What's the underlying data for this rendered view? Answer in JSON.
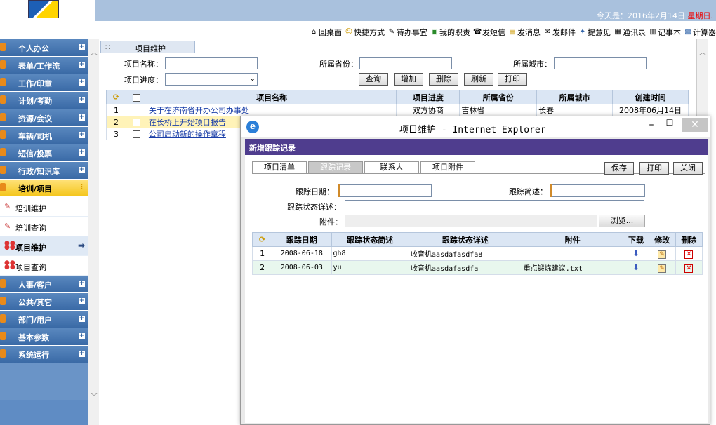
{
  "header": {
    "today_prefix": "今天是：2016年2月14日 ",
    "weekday": "星期日."
  },
  "toolbar": {
    "items": [
      {
        "label": "回桌面",
        "icon": "home-icon"
      },
      {
        "label": "快捷方式",
        "icon": "smiley-icon"
      },
      {
        "label": "待办事宜",
        "icon": "edit-note-icon"
      },
      {
        "label": "我的职责",
        "icon": "duty-icon"
      },
      {
        "label": "发短信",
        "icon": "phone-icon"
      },
      {
        "label": "发消息",
        "icon": "folder-icon"
      },
      {
        "label": "发邮件",
        "icon": "mail-icon"
      },
      {
        "label": "提意见",
        "icon": "feedback-icon"
      },
      {
        "label": "通讯录",
        "icon": "addressbook-icon"
      },
      {
        "label": "记事本",
        "icon": "notepad-icon"
      },
      {
        "label": "计算器",
        "icon": "calculator-icon"
      }
    ]
  },
  "sidebar": {
    "items": [
      {
        "label": "个人办公"
      },
      {
        "label": "表单/工作流"
      },
      {
        "label": "工作/印章"
      },
      {
        "label": "计划/考勤"
      },
      {
        "label": "资源/会议"
      },
      {
        "label": "车辆/司机"
      },
      {
        "label": "短信/投票"
      },
      {
        "label": "行政/知识库"
      },
      {
        "label": "培训/项目"
      }
    ],
    "sub_items": [
      {
        "label": "培训维护"
      },
      {
        "label": "培训查询"
      },
      {
        "label": "项目维护"
      },
      {
        "label": "项目查询"
      }
    ],
    "items_after": [
      {
        "label": "人事/客户"
      },
      {
        "label": "公共/其它"
      },
      {
        "label": "部门/用户"
      },
      {
        "label": "基本参数"
      },
      {
        "label": "系统运行"
      }
    ]
  },
  "main": {
    "tab_label": "项目维护",
    "filters": {
      "name_label": "项目名称：",
      "province_label": "所属省份：",
      "city_label": "所属城市：",
      "progress_label": "项目进度："
    },
    "buttons": {
      "query": "查询",
      "add": "增加",
      "delete": "删除",
      "refresh": "刷新",
      "print": "打印"
    },
    "table": {
      "headers": [
        "项目名称",
        "项目进度",
        "所属省份",
        "所属城市",
        "创建时间"
      ],
      "rows": [
        {
          "no": "1",
          "name": "关于在济南省开办公司办事处",
          "progress": "双方协商",
          "province": "吉林省",
          "city": "长春",
          "created": "2008年06月14日"
        },
        {
          "no": "2",
          "name": "在长桥上开始项目报告",
          "progress": "",
          "province": "",
          "city": "",
          "created": ""
        },
        {
          "no": "3",
          "name": "公司启动新的操作章程",
          "progress": "",
          "province": "",
          "city": "",
          "created": ""
        }
      ]
    }
  },
  "popup": {
    "window_title": "项目维护 - Internet Explorer",
    "header": "新增跟踪记录",
    "tabs": [
      "项目清单",
      "跟踪记录",
      "联系人",
      "项目附件"
    ],
    "active_tab": 1,
    "buttons": {
      "save": "保存",
      "print": "打印",
      "close": "关闭"
    },
    "form": {
      "date_label": "跟踪日期：",
      "brief_label": "跟踪简述：",
      "detail_label": "跟踪状态详述：",
      "attach_label": "附件：",
      "browse": "浏览..."
    },
    "table": {
      "headers": [
        "跟踪日期",
        "跟踪状态简述",
        "跟踪状态详述",
        "附件",
        "下载",
        "修改",
        "删除"
      ],
      "rows": [
        {
          "no": "1",
          "date": "2008-06-18",
          "brief": "gh8",
          "detail": "收音机aasdafasdfa8",
          "attachment": ""
        },
        {
          "no": "2",
          "date": "2008-06-03",
          "brief": "yu",
          "detail": "收音机aasdafasdfa",
          "attachment": "重点锻炼建议.txt"
        }
      ]
    }
  },
  "colors": {
    "banner": "#a9c1dd",
    "menu_blue": "#3a6aa6",
    "menu_active": "#f4c51a",
    "popup_header": "#4f3d8e",
    "link": "#1a3ea8"
  }
}
